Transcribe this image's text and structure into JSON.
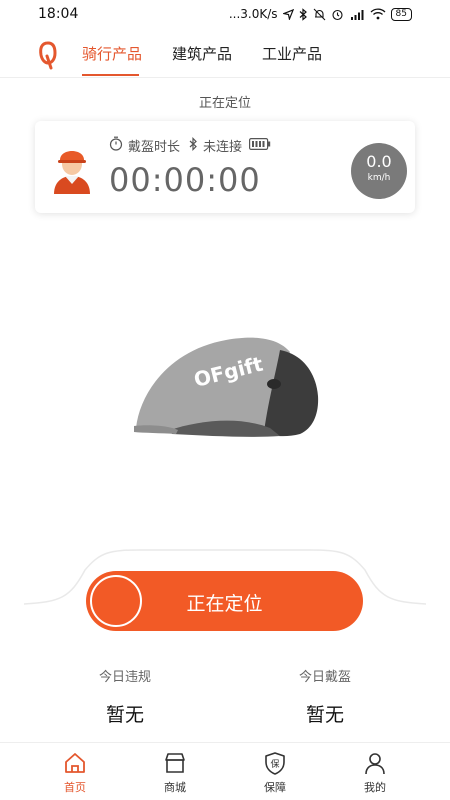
{
  "status_bar": {
    "time": "18:04",
    "network_speed": "...3.0K/s",
    "battery": "85",
    "icons": [
      "navigation-arrow-icon",
      "bluetooth-icon",
      "alarm-off-icon",
      "alarm-clock-icon",
      "signal-4g-icon",
      "wifi-icon",
      "battery-icon"
    ]
  },
  "top_tabs": [
    {
      "label": "骑行产品",
      "active": true
    },
    {
      "label": "建筑产品",
      "active": false
    },
    {
      "label": "工业产品",
      "active": false
    }
  ],
  "locating_status": "正在定位",
  "info_card": {
    "wear_duration_label": "戴盔时长",
    "connection_status": "未连接",
    "timer": "00:00:00",
    "speed_value": "0.0",
    "speed_unit": "km/h"
  },
  "helmet": {
    "brand_text": "OFgift"
  },
  "locate_button": {
    "label": "正在定位"
  },
  "stats": [
    {
      "label": "今日违规",
      "value": "暂无"
    },
    {
      "label": "今日戴盔",
      "value": "暂无"
    }
  ],
  "bottom_nav": [
    {
      "label": "首页",
      "icon": "home-icon",
      "active": true
    },
    {
      "label": "商城",
      "icon": "store-icon",
      "active": false
    },
    {
      "label": "保障",
      "icon": "shield-icon",
      "active": false
    },
    {
      "label": "我的",
      "icon": "user-icon",
      "active": false
    }
  ],
  "colors": {
    "accent": "#e4572e",
    "button": "#f25a26",
    "speed_badge": "#7a7a7a"
  }
}
